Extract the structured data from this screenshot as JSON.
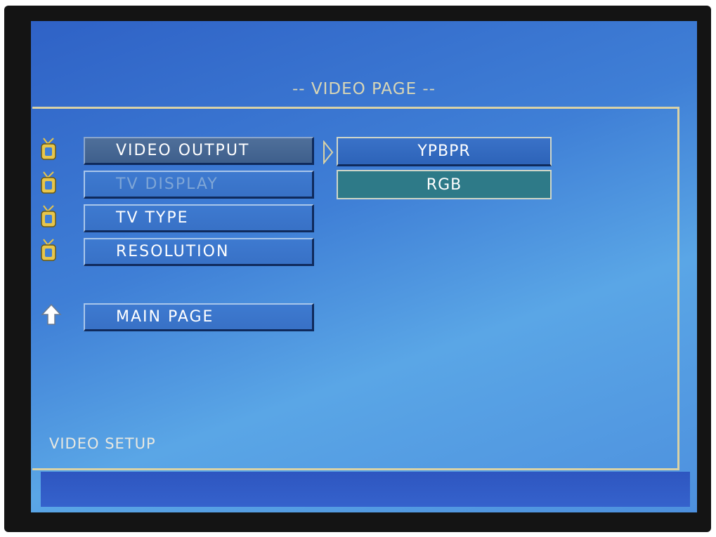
{
  "title": "-- VIDEO PAGE --",
  "menu": {
    "items": [
      {
        "label": "VIDEO OUTPUT",
        "state": "selected"
      },
      {
        "label": "TV DISPLAY",
        "state": "disabled"
      },
      {
        "label": "TV TYPE",
        "state": "normal"
      },
      {
        "label": "RESOLUTION",
        "state": "normal"
      }
    ],
    "main_page": "MAIN PAGE"
  },
  "options": [
    {
      "label": "YPBPR"
    },
    {
      "label": "RGB",
      "state": "highlighted"
    }
  ],
  "footer": "VIDEO SETUP",
  "icons": {
    "menu_item_icon": "tv-icon",
    "main_page_icon": "up-arrow-icon",
    "submenu_indicator": "chevron-right-icon"
  },
  "colors": {
    "screen_blue": "#3f7fd6",
    "frame_gold": "#d9d2a6",
    "icon_gold": "#e8c64a",
    "rgb_highlight": "#2e7a88"
  }
}
